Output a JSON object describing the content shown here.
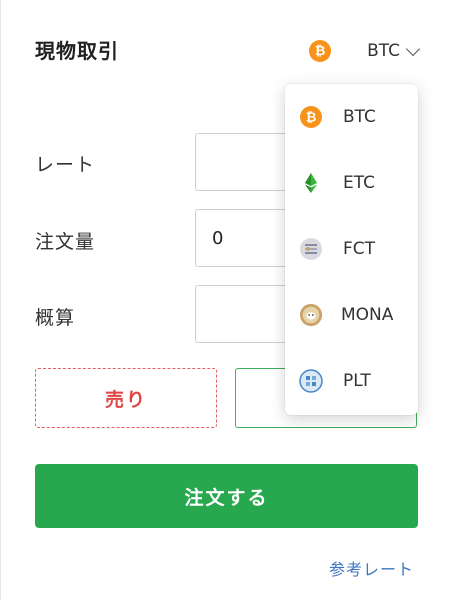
{
  "header": {
    "title": "現物取引",
    "selected_coin": "BTC",
    "selected_coin_icon": "bitcoin-icon"
  },
  "form": {
    "rate_label": "レート",
    "rate_value": "",
    "amount_label": "注文量",
    "amount_value": "0",
    "estimate_label": "概算",
    "estimate_value": ""
  },
  "buttons": {
    "sell_label": "売り",
    "buy_label": "",
    "order_label": "注文する"
  },
  "links": {
    "reference_rate": "参考レート"
  },
  "dropdown": {
    "items": [
      {
        "symbol": "BTC",
        "icon": "bitcoin-icon"
      },
      {
        "symbol": "ETC",
        "icon": "ethereum-classic-icon"
      },
      {
        "symbol": "FCT",
        "icon": "factom-icon"
      },
      {
        "symbol": "MONA",
        "icon": "monacoin-icon"
      },
      {
        "symbol": "PLT",
        "icon": "palette-token-icon"
      }
    ]
  },
  "colors": {
    "bitcoin": "#f7931a",
    "ethereum_classic": "#3ab83a",
    "sell": "#e04545",
    "buy": "#2aa04a",
    "order_button": "#27a74e",
    "link": "#3a76c4",
    "mona": "#c8a46a",
    "plt": "#4a86c8"
  }
}
